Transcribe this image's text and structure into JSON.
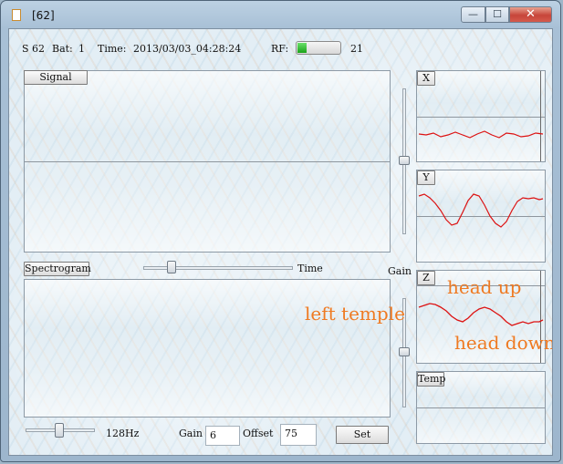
{
  "window": {
    "title": "[62]"
  },
  "status": {
    "station": "S 62",
    "battery_label": "Bat:",
    "battery_value": "1",
    "time_label": "Time:",
    "time_value": "2013/03/03_04:28:24",
    "rf_label": "RF:",
    "rf_value": "21",
    "rf_level": 0.21
  },
  "signal": {
    "label": "Signal"
  },
  "spectrogram": {
    "label": "Spectrogram",
    "time_label": "Time"
  },
  "gain_slider_label": "Gain",
  "axes": {
    "x": "X",
    "y": "Y",
    "z": "Z",
    "temp": "Temp"
  },
  "bottom": {
    "freq": "128Hz",
    "gain_label": "Gain",
    "gain_value": "6",
    "offset_label": "Offset",
    "offset_value": "75",
    "set_label": "Set"
  },
  "annotations": {
    "left_temple": "left temple",
    "head_up": "head up",
    "head_down": "head down"
  },
  "colors": {
    "trace": "#dd1111",
    "annotation": "#ef7a22",
    "rf_fill": "#19a319"
  }
}
